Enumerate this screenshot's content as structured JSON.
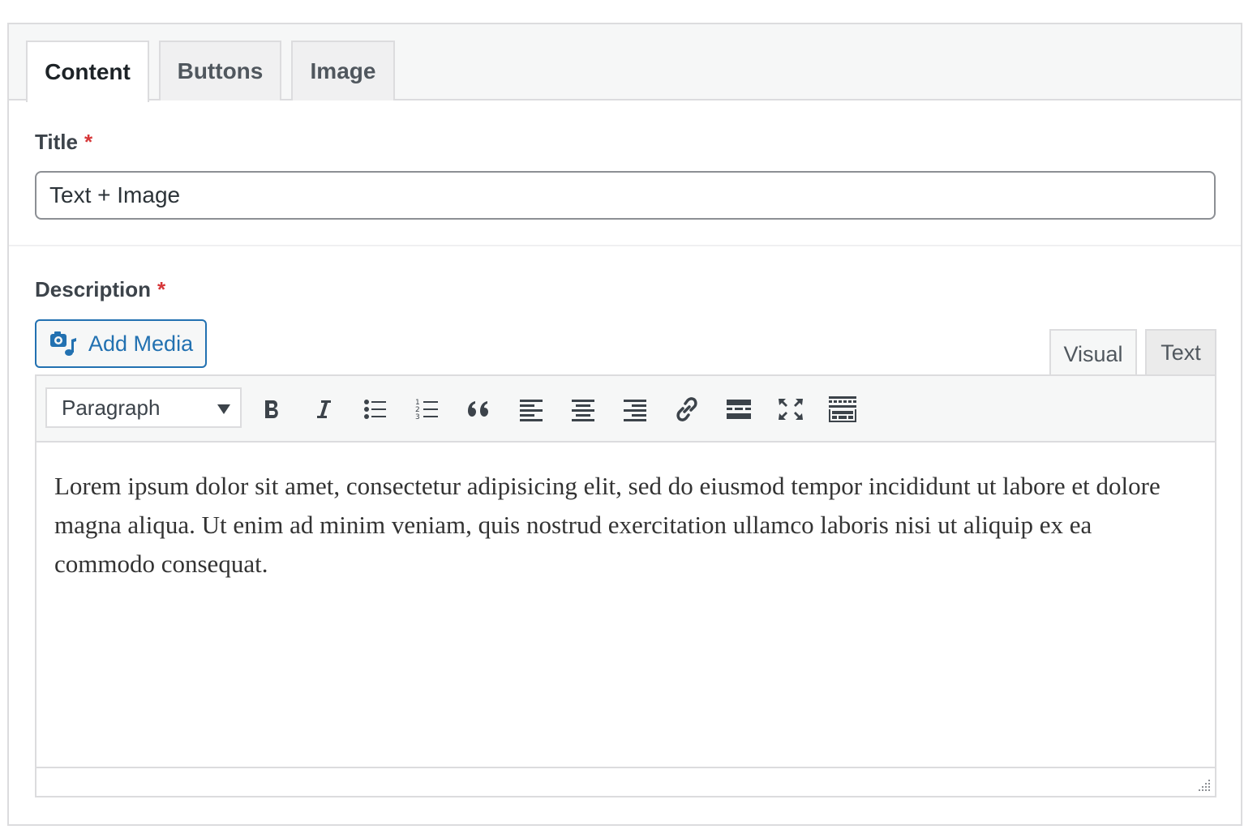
{
  "tabs": [
    {
      "label": "Content",
      "active": true
    },
    {
      "label": "Buttons",
      "active": false
    },
    {
      "label": "Image",
      "active": false
    }
  ],
  "title_field": {
    "label": "Title",
    "required_mark": "*",
    "value": "Text + Image"
  },
  "description_field": {
    "label": "Description",
    "required_mark": "*"
  },
  "add_media": {
    "label": "Add Media",
    "icon": "add-media-icon"
  },
  "editor_modes": {
    "visual": "Visual",
    "text": "Text",
    "active": "visual"
  },
  "toolbar": {
    "format_select": "Paragraph",
    "buttons": [
      "bold",
      "italic",
      "bullet-list",
      "numbered-list",
      "blockquote",
      "align-left",
      "align-center",
      "align-right",
      "link",
      "read-more",
      "fullscreen",
      "toolbar-toggle"
    ]
  },
  "editor_content": "Lorem ipsum dolor sit amet, consectetur adipisicing elit, sed do eiusmod tempor incididunt ut labore et dolore magna aliqua. Ut enim ad minim veniam, quis nostrud exercitation ullamco laboris nisi ut aliquip ex ea commodo consequat.",
  "colors": {
    "accent": "#2271b1",
    "required": "#d63638",
    "border": "#dcdcde"
  }
}
